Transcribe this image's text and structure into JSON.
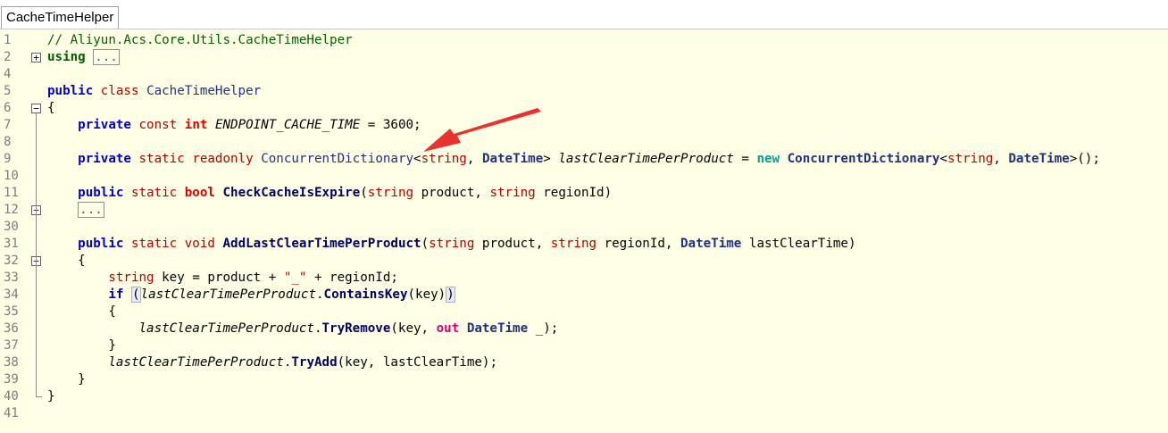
{
  "tab": {
    "title": "CacheTimeHelper"
  },
  "colors": {
    "arrow": "#e8322e",
    "editor_bg": "#ffffe6"
  },
  "lines": [
    {
      "num": "1",
      "tokens": [
        [
          "cm",
          "// Aliyun.Acs.Core.Utils.CacheTimeHelper"
        ]
      ]
    },
    {
      "num": "2",
      "fold": "+",
      "tokens": [
        [
          "kwg",
          "using"
        ],
        [
          "p",
          " "
        ],
        [
          "collapsed",
          "..."
        ]
      ]
    },
    {
      "num": "4",
      "tokens": []
    },
    {
      "num": "5",
      "tokens": [
        [
          "kw",
          "public"
        ],
        [
          "p",
          " "
        ],
        [
          "kw2",
          "class"
        ],
        [
          "p",
          " "
        ],
        [
          "ty",
          "CacheTimeHelper"
        ]
      ]
    },
    {
      "num": "6",
      "fold": "-",
      "tokens": [
        [
          "p",
          "{"
        ]
      ]
    },
    {
      "num": "7",
      "tokens": [
        [
          "p",
          "    "
        ],
        [
          "kw",
          "private"
        ],
        [
          "p",
          " "
        ],
        [
          "kw2",
          "const"
        ],
        [
          "p",
          " "
        ],
        [
          "kwr",
          "int"
        ],
        [
          "p",
          " "
        ],
        [
          "ital",
          "ENDPOINT_CACHE_TIME"
        ],
        [
          "p",
          " = 3600;"
        ]
      ]
    },
    {
      "num": "8",
      "tokens": []
    },
    {
      "num": "9",
      "tokens": [
        [
          "p",
          "    "
        ],
        [
          "kw",
          "private"
        ],
        [
          "p",
          " "
        ],
        [
          "kw2",
          "static"
        ],
        [
          "p",
          " "
        ],
        [
          "kw2",
          "readonly"
        ],
        [
          "p",
          " "
        ],
        [
          "ty",
          "ConcurrentDictionary"
        ],
        [
          "p",
          "<"
        ],
        [
          "kw2",
          "string"
        ],
        [
          "p",
          ", "
        ],
        [
          "tyb",
          "DateTime"
        ],
        [
          "p",
          "> "
        ],
        [
          "ital",
          "lastClearTimePerProduct"
        ],
        [
          "p",
          " = "
        ],
        [
          "kwn",
          "new"
        ],
        [
          "p",
          " "
        ],
        [
          "tyb",
          "ConcurrentDictionary"
        ],
        [
          "p",
          "<"
        ],
        [
          "kw2",
          "string"
        ],
        [
          "p",
          ", "
        ],
        [
          "tyb",
          "DateTime"
        ],
        [
          "p",
          ">();"
        ]
      ]
    },
    {
      "num": "10",
      "tokens": []
    },
    {
      "num": "11",
      "tokens": [
        [
          "p",
          "    "
        ],
        [
          "kw",
          "public"
        ],
        [
          "p",
          " "
        ],
        [
          "kw2",
          "static"
        ],
        [
          "p",
          " "
        ],
        [
          "kwr",
          "bool"
        ],
        [
          "p",
          " "
        ],
        [
          "mth",
          "CheckCacheIsExpire"
        ],
        [
          "p",
          "("
        ],
        [
          "kw2",
          "string"
        ],
        [
          "p",
          " product, "
        ],
        [
          "kw2",
          "string"
        ],
        [
          "p",
          " regionId)"
        ]
      ]
    },
    {
      "num": "12",
      "fold": "+",
      "tokens": [
        [
          "p",
          "    "
        ],
        [
          "collapsed",
          "..."
        ]
      ]
    },
    {
      "num": "30",
      "tokens": []
    },
    {
      "num": "31",
      "tokens": [
        [
          "p",
          "    "
        ],
        [
          "kw",
          "public"
        ],
        [
          "p",
          " "
        ],
        [
          "kw2",
          "static"
        ],
        [
          "p",
          " "
        ],
        [
          "kw2",
          "void"
        ],
        [
          "p",
          " "
        ],
        [
          "mth",
          "AddLastClearTimePerProduct"
        ],
        [
          "p",
          "("
        ],
        [
          "kw2",
          "string"
        ],
        [
          "p",
          " product, "
        ],
        [
          "kw2",
          "string"
        ],
        [
          "p",
          " regionId, "
        ],
        [
          "tyb",
          "DateTime"
        ],
        [
          "p",
          " lastClearTime)"
        ]
      ]
    },
    {
      "num": "32",
      "fold": "-",
      "tokens": [
        [
          "p",
          "    {"
        ]
      ]
    },
    {
      "num": "33",
      "tokens": [
        [
          "p",
          "        "
        ],
        [
          "kw2",
          "string"
        ],
        [
          "p",
          " key = product + "
        ],
        [
          "str",
          "\"_\""
        ],
        [
          "p",
          " + regionId;"
        ]
      ]
    },
    {
      "num": "34",
      "tokens": [
        [
          "p",
          "        "
        ],
        [
          "kw",
          "if"
        ],
        [
          "p",
          " "
        ],
        [
          "hl",
          "("
        ],
        [
          "ital",
          "lastClearTimePerProduct"
        ],
        [
          "p",
          "."
        ],
        [
          "mth",
          "ContainsKey"
        ],
        [
          "p",
          "(key)"
        ],
        [
          "hl",
          ")"
        ]
      ]
    },
    {
      "num": "35",
      "tokens": [
        [
          "p",
          "        {"
        ]
      ]
    },
    {
      "num": "36",
      "tokens": [
        [
          "p",
          "            "
        ],
        [
          "ital",
          "lastClearTimePerProduct"
        ],
        [
          "p",
          "."
        ],
        [
          "mth",
          "TryRemove"
        ],
        [
          "p",
          "(key, "
        ],
        [
          "outpink",
          "out"
        ],
        [
          "p",
          " "
        ],
        [
          "tyb",
          "DateTime"
        ],
        [
          "p",
          " _);"
        ]
      ]
    },
    {
      "num": "37",
      "tokens": [
        [
          "p",
          "        }"
        ]
      ]
    },
    {
      "num": "38",
      "tokens": [
        [
          "p",
          "        "
        ],
        [
          "ital",
          "lastClearTimePerProduct"
        ],
        [
          "p",
          "."
        ],
        [
          "mth",
          "TryAdd"
        ],
        [
          "p",
          "(key, lastClearTime);"
        ]
      ]
    },
    {
      "num": "39",
      "tokens": [
        [
          "p",
          "    }"
        ]
      ]
    },
    {
      "num": "40",
      "end": true,
      "tokens": [
        [
          "p",
          "}"
        ]
      ]
    },
    {
      "num": "41",
      "tokens": []
    }
  ]
}
